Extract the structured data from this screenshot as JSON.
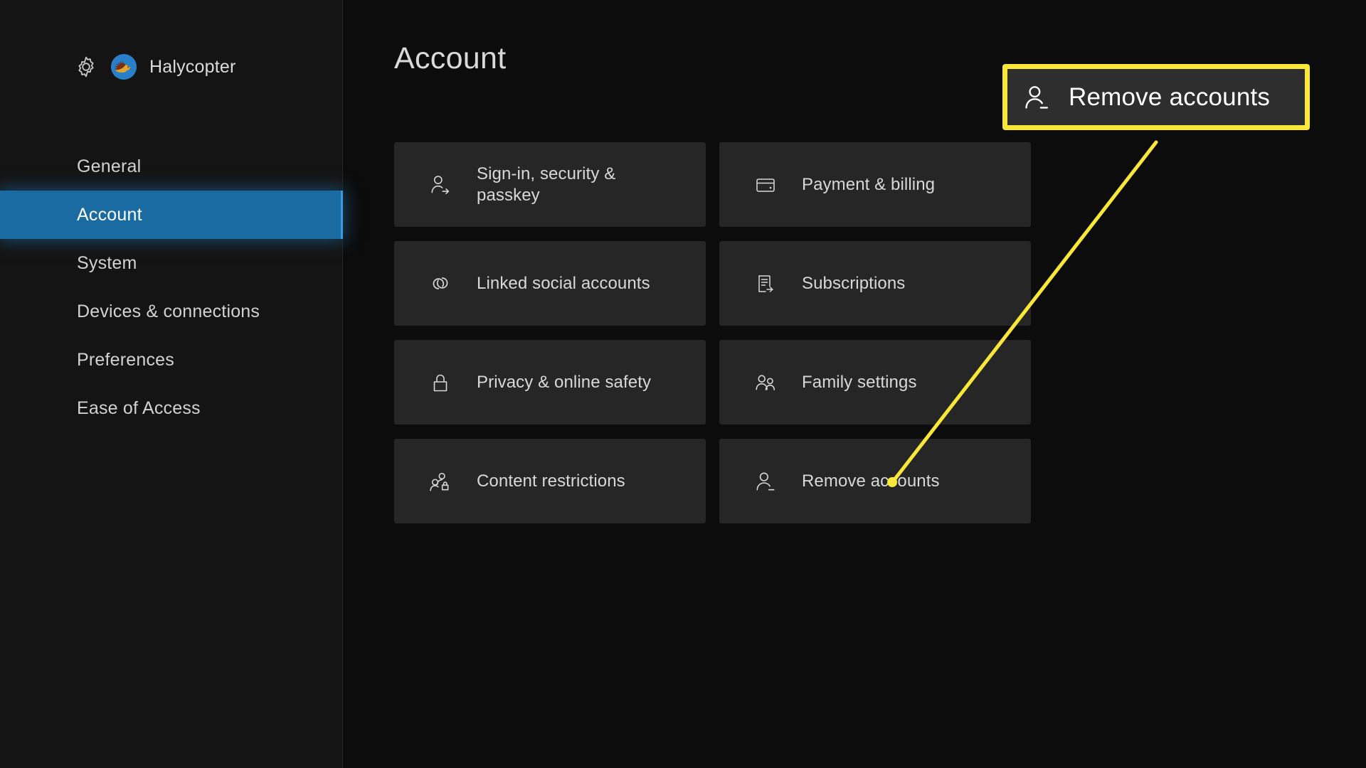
{
  "profile": {
    "gear_icon": "gear-icon",
    "avatar_icon": "hedgehog-avatar",
    "name": "Halycopter"
  },
  "sidebar": {
    "items": [
      {
        "label": "General",
        "selected": false
      },
      {
        "label": "Account",
        "selected": true
      },
      {
        "label": "System",
        "selected": false
      },
      {
        "label": "Devices & connections",
        "selected": false
      },
      {
        "label": "Preferences",
        "selected": false
      },
      {
        "label": "Ease of Access",
        "selected": false
      }
    ]
  },
  "main": {
    "title": "Account",
    "tiles": [
      {
        "label": "Sign-in, security & passkey",
        "icon": "person-arrow-icon"
      },
      {
        "label": "Payment & billing",
        "icon": "credit-card-icon"
      },
      {
        "label": "Linked social accounts",
        "icon": "link-chain-icon"
      },
      {
        "label": "Subscriptions",
        "icon": "document-arrow-icon"
      },
      {
        "label": "Privacy & online safety",
        "icon": "padlock-icon"
      },
      {
        "label": "Family settings",
        "icon": "two-people-icon"
      },
      {
        "label": "Content restrictions",
        "icon": "people-lock-icon"
      },
      {
        "label": "Remove accounts",
        "icon": "person-minus-icon"
      }
    ]
  },
  "callout": {
    "label": "Remove accounts",
    "icon": "person-minus-icon",
    "border_color": "#f9e838",
    "background_color": "#2e2e2e"
  },
  "colors": {
    "app_background": "#0c0c0c",
    "sidebar_background": "#141414",
    "tile_background": "#262626",
    "selection_blue": "#1b6ba3",
    "highlight_yellow": "#f9e838",
    "text_primary": "#d8d8d8"
  }
}
